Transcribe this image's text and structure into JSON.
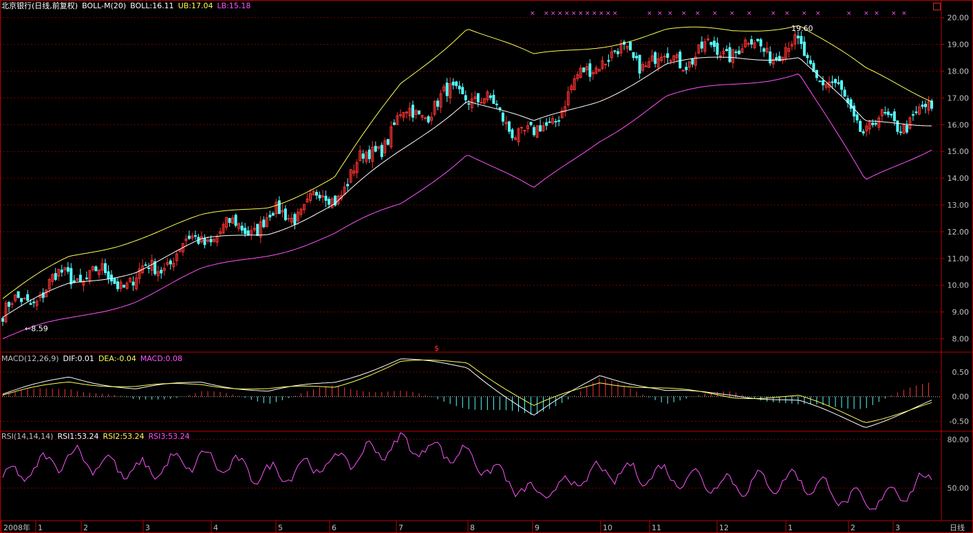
{
  "window": {
    "period_label": "日线"
  },
  "main_panel": {
    "legend": {
      "stock": "北京银行(日线,前复权)",
      "indicator": "BOLL-M(20)",
      "boll": "BOLL:16.11",
      "ub": "UB:17.04",
      "lb": "LB:15.18"
    },
    "price_ticks": [
      "20.00",
      "19.00",
      "18.00",
      "17.00",
      "16.00",
      "15.00",
      "14.00",
      "13.00",
      "12.00",
      "11.00",
      "10.00",
      "9.00",
      "8.00"
    ],
    "annotations": {
      "low": "←8.59",
      "high": "19.60",
      "marker": "$"
    }
  },
  "macd_panel": {
    "legend": {
      "name": "MACD(12,26,9)",
      "dif": "DIF:0.01",
      "dea": "DEA:-0.04",
      "macd": "MACD:0.08"
    },
    "ticks": [
      "0.50",
      "0.00",
      "-0.50"
    ]
  },
  "rsi_panel": {
    "legend": {
      "name": "RSI(14,14,14)",
      "rsi1": "RSI1:53.24",
      "rsi2": "RSI2:53.24",
      "rsi3": "RSI3:53.24"
    },
    "ticks": [
      "80.00",
      "50.00"
    ]
  },
  "x_axis": {
    "labels": [
      "2008年",
      "1",
      "2",
      "3",
      "4",
      "5",
      "6",
      "7",
      "8",
      "9",
      "10",
      "11",
      "12",
      "1",
      "2",
      "3"
    ]
  },
  "colors": {
    "up": "#ff3232",
    "down": "#54ffff",
    "mid": "#ffffff",
    "ub": "#ffff54",
    "lb": "#ff54ff",
    "axis": "#c00000",
    "grid": "#800000",
    "label": "#c0c0c0"
  },
  "chart_data": [
    {
      "type": "candlestick",
      "title": "北京银行(日线,前复权)",
      "ylim": [
        7.5,
        20.3
      ],
      "x": [
        "2008-01",
        "2008-02",
        "2008-03",
        "2008-04",
        "2008-05",
        "2008-06",
        "2008-07",
        "2008-08",
        "2008-09",
        "2008-10",
        "2008-11",
        "2008-12",
        "2009-01",
        "2009-02",
        "2009-03"
      ],
      "close_trend": [
        8.9,
        10.4,
        10.2,
        11.8,
        12.4,
        13.4,
        16.2,
        17.3,
        15.4,
        18.6,
        18.4,
        18.9,
        18.8,
        15.9,
        16.4
      ],
      "series": [
        {
          "name": "BOLL",
          "values": [
            8.8,
            10.0,
            10.6,
            11.6,
            12.0,
            13.0,
            15.0,
            17.0,
            16.0,
            17.0,
            18.2,
            18.5,
            18.6,
            16.0,
            16.1
          ]
        },
        {
          "name": "UB",
          "values": [
            9.5,
            11.0,
            11.8,
            12.5,
            13.0,
            14.0,
            17.5,
            19.7,
            18.5,
            19.0,
            19.5,
            19.5,
            19.8,
            18.0,
            17.0
          ]
        },
        {
          "name": "LB",
          "values": [
            8.0,
            8.7,
            9.5,
            10.5,
            11.2,
            11.9,
            13.0,
            15.0,
            13.5,
            15.5,
            17.0,
            17.5,
            18.0,
            13.8,
            15.2
          ]
        }
      ],
      "last": {
        "BOLL": 16.11,
        "UB": 17.04,
        "LB": 15.18
      },
      "marked_low": 8.59,
      "marked_high": 19.6
    },
    {
      "type": "bar+line",
      "title": "MACD(12,26,9)",
      "ylim": [
        -0.7,
        0.9
      ],
      "x": [
        "2008-01",
        "2008-02",
        "2008-03",
        "2008-04",
        "2008-05",
        "2008-06",
        "2008-07",
        "2008-08",
        "2008-09",
        "2008-10",
        "2008-11",
        "2008-12",
        "2009-01",
        "2009-02",
        "2009-03"
      ],
      "series": [
        {
          "name": "DIF",
          "values": [
            0.05,
            0.4,
            0.15,
            0.3,
            0.1,
            0.3,
            0.75,
            0.6,
            -0.4,
            0.45,
            0.1,
            0.05,
            -0.1,
            -0.6,
            -0.1
          ]
        },
        {
          "name": "DEA",
          "values": [
            0.03,
            0.3,
            0.2,
            0.25,
            0.15,
            0.2,
            0.7,
            0.7,
            -0.2,
            0.3,
            0.15,
            0.0,
            0.0,
            -0.5,
            -0.15
          ]
        },
        {
          "name": "MACD",
          "values": [
            0.04,
            0.2,
            -0.1,
            0.1,
            -0.1,
            0.2,
            0.1,
            -0.2,
            -0.4,
            0.35,
            -0.1,
            0.1,
            -0.2,
            -0.2,
            0.3
          ]
        }
      ],
      "last": {
        "DIF": 0.01,
        "DEA": -0.04,
        "MACD": 0.08
      }
    },
    {
      "type": "line",
      "title": "RSI(14,14,14)",
      "ylim": [
        30,
        85
      ],
      "x": [
        "2008-01",
        "2008-02",
        "2008-03",
        "2008-04",
        "2008-05",
        "2008-06",
        "2008-07",
        "2008-08",
        "2008-09",
        "2008-10",
        "2008-11",
        "2008-12",
        "2009-01",
        "2009-02",
        "2009-03"
      ],
      "series": [
        {
          "name": "RSI",
          "values": [
            55,
            70,
            60,
            68,
            58,
            66,
            77,
            70,
            45,
            60,
            58,
            52,
            55,
            40,
            55
          ]
        }
      ],
      "last": {
        "RSI1": 53.24,
        "RSI2": 53.24,
        "RSI3": 53.24
      }
    }
  ]
}
